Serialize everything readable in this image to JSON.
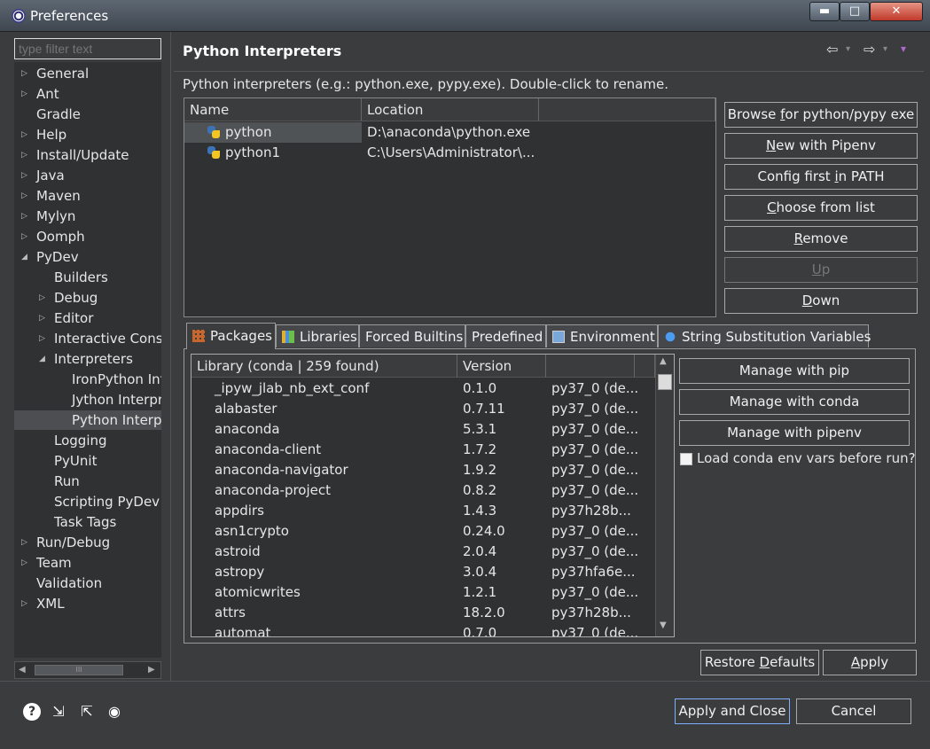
{
  "window": {
    "title": "Preferences",
    "minimize_glyph": "▬",
    "maximize_glyph": "□",
    "close_glyph": "✕"
  },
  "filter": {
    "placeholder": "type filter text"
  },
  "tree": [
    {
      "label": "General",
      "expander": "▷",
      "level": 0
    },
    {
      "label": "Ant",
      "expander": "▷",
      "level": 0
    },
    {
      "label": "Gradle",
      "expander": "",
      "level": 0
    },
    {
      "label": "Help",
      "expander": "▷",
      "level": 0
    },
    {
      "label": "Install/Update",
      "expander": "▷",
      "level": 0
    },
    {
      "label": "Java",
      "expander": "▷",
      "level": 0
    },
    {
      "label": "Maven",
      "expander": "▷",
      "level": 0
    },
    {
      "label": "Mylyn",
      "expander": "▷",
      "level": 0
    },
    {
      "label": "Oomph",
      "expander": "▷",
      "level": 0
    },
    {
      "label": "PyDev",
      "expander": "◢",
      "level": 0
    },
    {
      "label": "Builders",
      "expander": "",
      "level": 1
    },
    {
      "label": "Debug",
      "expander": "▷",
      "level": 1
    },
    {
      "label": "Editor",
      "expander": "▷",
      "level": 1
    },
    {
      "label": "Interactive Console",
      "expander": "▷",
      "level": 1
    },
    {
      "label": "Interpreters",
      "expander": "◢",
      "level": 1
    },
    {
      "label": "IronPython Interpreter",
      "expander": "",
      "level": 2
    },
    {
      "label": "Jython Interpreter",
      "expander": "",
      "level": 2
    },
    {
      "label": "Python Interpreter",
      "expander": "",
      "level": 2,
      "selected": true
    },
    {
      "label": "Logging",
      "expander": "",
      "level": 1
    },
    {
      "label": "PyUnit",
      "expander": "",
      "level": 1
    },
    {
      "label": "Run",
      "expander": "",
      "level": 1
    },
    {
      "label": "Scripting PyDev",
      "expander": "",
      "level": 1
    },
    {
      "label": "Task Tags",
      "expander": "",
      "level": 1
    },
    {
      "label": "Run/Debug",
      "expander": "▷",
      "level": 0
    },
    {
      "label": "Team",
      "expander": "▷",
      "level": 0
    },
    {
      "label": "Validation",
      "expander": "",
      "level": 0
    },
    {
      "label": "XML",
      "expander": "▷",
      "level": 0
    }
  ],
  "hscroll": {
    "left_glyph": "◀",
    "thumb_glyph": "III",
    "right_glyph": "▶"
  },
  "page": {
    "title": "Python Interpreters",
    "nav": {
      "back_glyph": "⇦",
      "forward_glyph": "⇨",
      "menu_glyph": "▾",
      "dropdown_glyph": "▾"
    },
    "description": "Python interpreters (e.g.: python.exe, pypy.exe).   Double-click to rename."
  },
  "interpreters": {
    "columns": [
      "Name",
      "Location"
    ],
    "rows": [
      {
        "name": "python",
        "location": "D:\\anaconda\\python.exe",
        "selected": true
      },
      {
        "name": "python1",
        "location": "C:\\Users\\Administrator\\..."
      }
    ]
  },
  "interp_buttons": [
    {
      "label": "Browse for python/pypy exe",
      "mnemonic_pre": "Browse ",
      "mnemonic": "f",
      "mnemonic_post": "or python/pypy exe",
      "enabled": true
    },
    {
      "label": "New with Pipenv",
      "mnemonic_pre": "",
      "mnemonic": "N",
      "mnemonic_post": "ew with Pipenv",
      "enabled": true
    },
    {
      "label": "Config first in PATH",
      "mnemonic_pre": "Config first ",
      "mnemonic": "i",
      "mnemonic_post": "n PATH",
      "enabled": true
    },
    {
      "label": "Choose from list",
      "mnemonic_pre": "",
      "mnemonic": "C",
      "mnemonic_post": "hoose from list",
      "enabled": true
    },
    {
      "label": "Remove",
      "mnemonic_pre": "",
      "mnemonic": "R",
      "mnemonic_post": "emove",
      "enabled": true
    },
    {
      "label": "Up",
      "mnemonic_pre": "",
      "mnemonic": "U",
      "mnemonic_post": "p",
      "enabled": false
    },
    {
      "label": "Down",
      "mnemonic_pre": "",
      "mnemonic": "D",
      "mnemonic_post": "own",
      "enabled": true
    }
  ],
  "tabs": [
    {
      "label": "Packages",
      "icon": "package-icon",
      "active": true
    },
    {
      "label": "Libraries",
      "icon": "libraries-icon"
    },
    {
      "label": "Forced Builtins",
      "icon": ""
    },
    {
      "label": "Predefined",
      "icon": ""
    },
    {
      "label": "Environment",
      "icon": "environment-icon"
    },
    {
      "label": "String Substitution Variables",
      "icon": "variable-icon"
    }
  ],
  "packages": {
    "columns": [
      "Library (conda | 259 found)",
      "Version"
    ],
    "rows": [
      {
        "name": "_ipyw_jlab_nb_ext_conf",
        "version": "0.1.0",
        "build": "py37_0 (de..."
      },
      {
        "name": "alabaster",
        "version": "0.7.11",
        "build": "py37_0 (de..."
      },
      {
        "name": "anaconda",
        "version": "5.3.1",
        "build": "py37_0 (de..."
      },
      {
        "name": "anaconda-client",
        "version": "1.7.2",
        "build": "py37_0 (de..."
      },
      {
        "name": "anaconda-navigator",
        "version": "1.9.2",
        "build": "py37_0 (de..."
      },
      {
        "name": "anaconda-project",
        "version": "0.8.2",
        "build": "py37_0 (de..."
      },
      {
        "name": "appdirs",
        "version": "1.4.3",
        "build": "py37h28b..."
      },
      {
        "name": "asn1crypto",
        "version": "0.24.0",
        "build": "py37_0 (de..."
      },
      {
        "name": "astroid",
        "version": "2.0.4",
        "build": "py37_0 (de..."
      },
      {
        "name": "astropy",
        "version": "3.0.4",
        "build": "py37hfa6e..."
      },
      {
        "name": "atomicwrites",
        "version": "1.2.1",
        "build": "py37_0 (de..."
      },
      {
        "name": "attrs",
        "version": "18.2.0",
        "build": "py37h28b..."
      },
      {
        "name": "automat",
        "version": "0.7.0",
        "build": "py37_0 (de..."
      }
    ],
    "scroll": {
      "up_glyph": "▲",
      "down_glyph": "▼"
    }
  },
  "manage_buttons": [
    "Manage with pip",
    "Manage with conda",
    "Manage with pipenv"
  ],
  "conda_env_checkbox": {
    "label": "Load conda env vars before run?",
    "checked": false
  },
  "page_buttons": {
    "restore_pre": "Restore ",
    "restore_mn": "D",
    "restore_post": "efaults",
    "apply_pre": "",
    "apply_mn": "A",
    "apply_post": "pply"
  },
  "footer": {
    "icons": [
      {
        "name": "help-icon",
        "glyph": "?"
      },
      {
        "name": "import-icon",
        "glyph": "⇲"
      },
      {
        "name": "export-icon",
        "glyph": "⇱"
      },
      {
        "name": "oomph-icon",
        "glyph": "◉"
      }
    ],
    "apply_close": "Apply and Close",
    "cancel": "Cancel"
  }
}
